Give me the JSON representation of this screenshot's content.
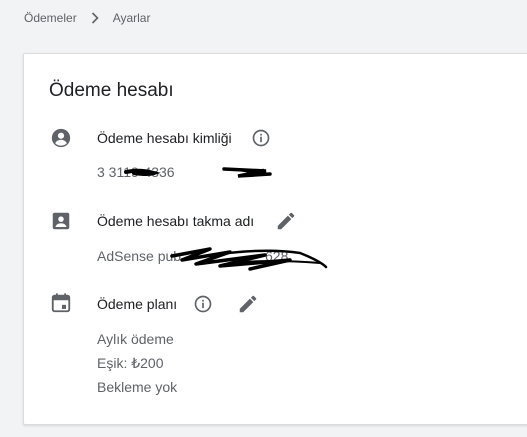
{
  "breadcrumb": {
    "parent": "Ödemeler",
    "current": "Ayarlar"
  },
  "card": {
    "title": "Ödeme hesabı"
  },
  "account_id": {
    "label": "Ödeme hesabı kimliği",
    "value": "3 3119-4336",
    "icon": "account-circle-icon",
    "action_icon": "info-icon"
  },
  "nickname": {
    "label": "Ödeme hesabı takma adı",
    "value_prefix": "AdSense pub",
    "value_suffix": "628",
    "icon": "account-box-icon",
    "action_icon": "pencil-icon"
  },
  "plan": {
    "label": "Ödeme planı",
    "icon": "calendar-icon",
    "info_icon": "info-icon",
    "action_icon": "pencil-icon",
    "lines": [
      "Aylık ödeme",
      "Eşik: ₺200",
      "Bekleme yok"
    ]
  },
  "colors": {
    "text_primary": "#202124",
    "text_secondary": "#5f6368",
    "icon": "#5f6368",
    "redaction": "#000000"
  }
}
